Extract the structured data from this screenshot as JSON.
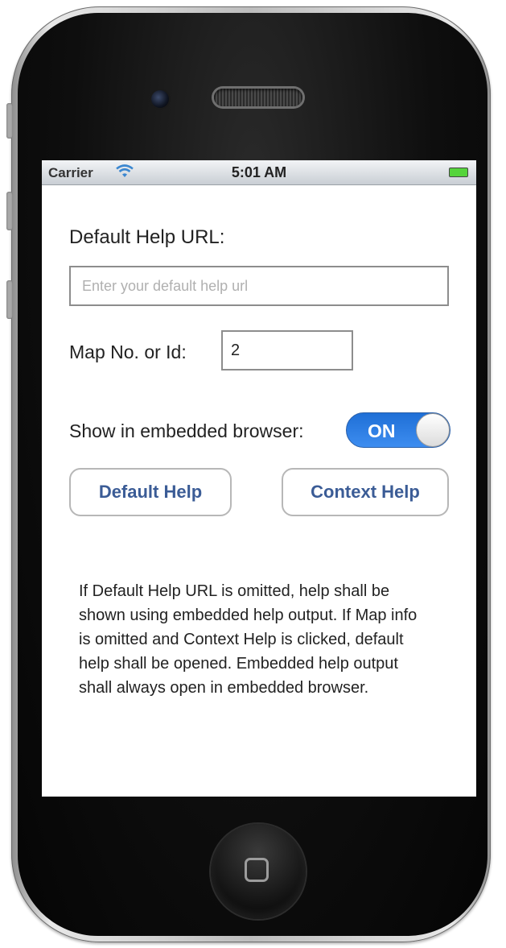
{
  "status_bar": {
    "carrier": "Carrier",
    "time": "5:01 AM",
    "wifi_icon": "wifi-icon",
    "battery_icon": "battery-icon"
  },
  "form": {
    "url_label": "Default Help URL:",
    "url_placeholder": "Enter your default help url",
    "url_value": "",
    "map_label": "Map No. or Id:",
    "map_value": "2",
    "embedded_label": "Show in embedded browser:",
    "embedded_switch_label": "ON"
  },
  "buttons": {
    "default_help": "Default Help",
    "context_help": "Context Help"
  },
  "note": "If Default Help URL is omitted, help shall be shown using embedded help output. If Map info is omitted and Context Help is clicked, default help shall be opened. Embedded help output shall always open in embedded browser.",
  "colors": {
    "switch_on": "#2f7de6",
    "button_text": "#3b5c96"
  }
}
